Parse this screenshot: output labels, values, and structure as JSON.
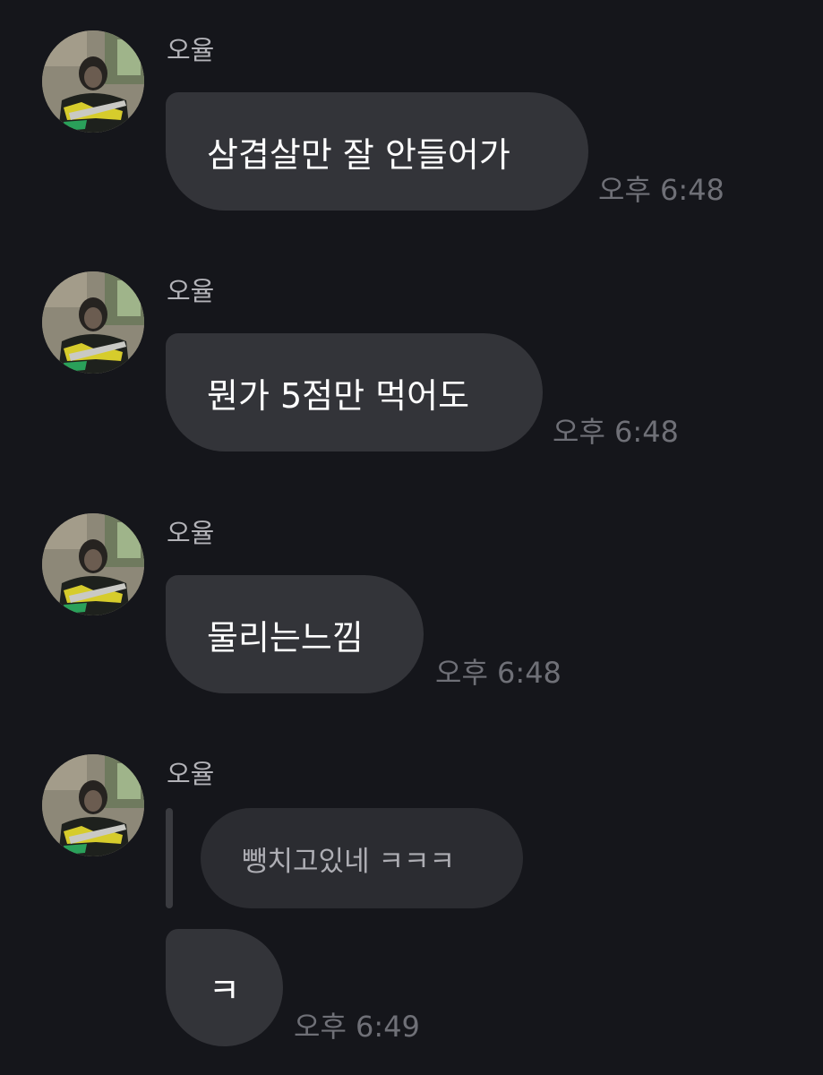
{
  "messages": [
    {
      "sender": "오율",
      "text": "삼겹살만 잘 안들어가",
      "time": "오후 6:48"
    },
    {
      "sender": "오율",
      "text": "뭔가 5점만 먹어도",
      "time": "오후 6:48"
    },
    {
      "sender": "오율",
      "text": "물리는느낌",
      "time": "오후 6:48"
    },
    {
      "sender": "오율",
      "quote": "뺑치고있네 ㅋㅋㅋ",
      "text": "ㅋ",
      "time": "오후 6:49"
    }
  ],
  "avatar": {
    "icon": "profile-photo-avatar"
  },
  "colors": {
    "background": "#15161b",
    "bubble": "#333439",
    "quote_bubble": "#2b2c31",
    "sender_text": "#b3b3b8",
    "time_text": "#6f7077"
  }
}
